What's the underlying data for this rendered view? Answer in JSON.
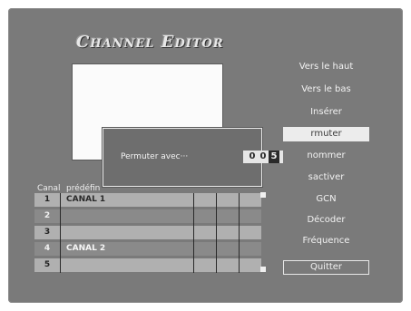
{
  "title": "Channel Editor",
  "menu": {
    "items": [
      {
        "label": "Vers le haut"
      },
      {
        "label": "Vers le bas"
      },
      {
        "label": "Insérer"
      },
      {
        "label": "rmuter"
      },
      {
        "label": "nommer"
      },
      {
        "label": "sactiver"
      },
      {
        "label": "GCN"
      },
      {
        "label": "Décoder"
      },
      {
        "label": "Fréquence"
      },
      {
        "label": "Quitter"
      }
    ]
  },
  "list": {
    "headers": {
      "canal": "Canal",
      "predefini": "prédéfin"
    },
    "rows": [
      {
        "num": "1",
        "name": "CANAL 1"
      },
      {
        "num": "2",
        "name": ""
      },
      {
        "num": "3",
        "name": ""
      },
      {
        "num": "4",
        "name": "CANAL 2"
      },
      {
        "num": "5",
        "name": ""
      }
    ]
  },
  "dialog": {
    "prompt": "Permuter avec···",
    "digits": [
      "0",
      "0",
      "5"
    ]
  }
}
